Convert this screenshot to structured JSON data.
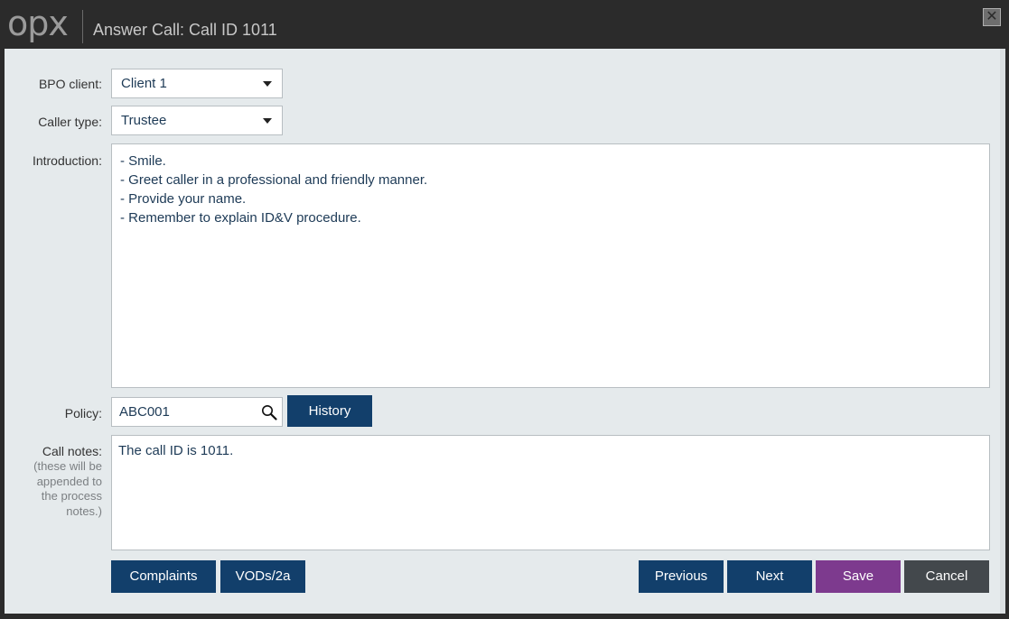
{
  "app": {
    "logo": "opx",
    "title": "Answer Call: Call ID 1011"
  },
  "window": {
    "close_symbol": "✕"
  },
  "form": {
    "bpo_client": {
      "label": "BPO client:",
      "value": "Client 1"
    },
    "caller_type": {
      "label": "Caller type:",
      "value": "Trustee"
    },
    "introduction": {
      "label": "Introduction:",
      "lines": [
        "- Smile.",
        "- Greet caller in a professional and friendly manner.",
        "- Provide your name.",
        "- Remember to explain ID&V procedure."
      ]
    },
    "policy": {
      "label": "Policy:",
      "value": "ABC001"
    },
    "call_notes": {
      "label": "Call notes:",
      "sublabel_lines": [
        "(these will be",
        "appended to",
        "the process",
        "notes.)"
      ],
      "value": "The call ID is 1011."
    }
  },
  "buttons": {
    "history": "History",
    "complaints": "Complaints",
    "vods": "VODs/2a",
    "previous": "Previous",
    "next": "Next",
    "save": "Save",
    "cancel": "Cancel"
  },
  "colors": {
    "primary_button": "#123f6b",
    "save_button": "#7d3a8e",
    "cancel_button": "#43484c",
    "titlebar": "#2b2b2b",
    "panel": "#e5eaec"
  },
  "icons": {
    "policy_search": "search-icon",
    "close": "close-icon",
    "dropdown": "chevron-down-icon"
  }
}
